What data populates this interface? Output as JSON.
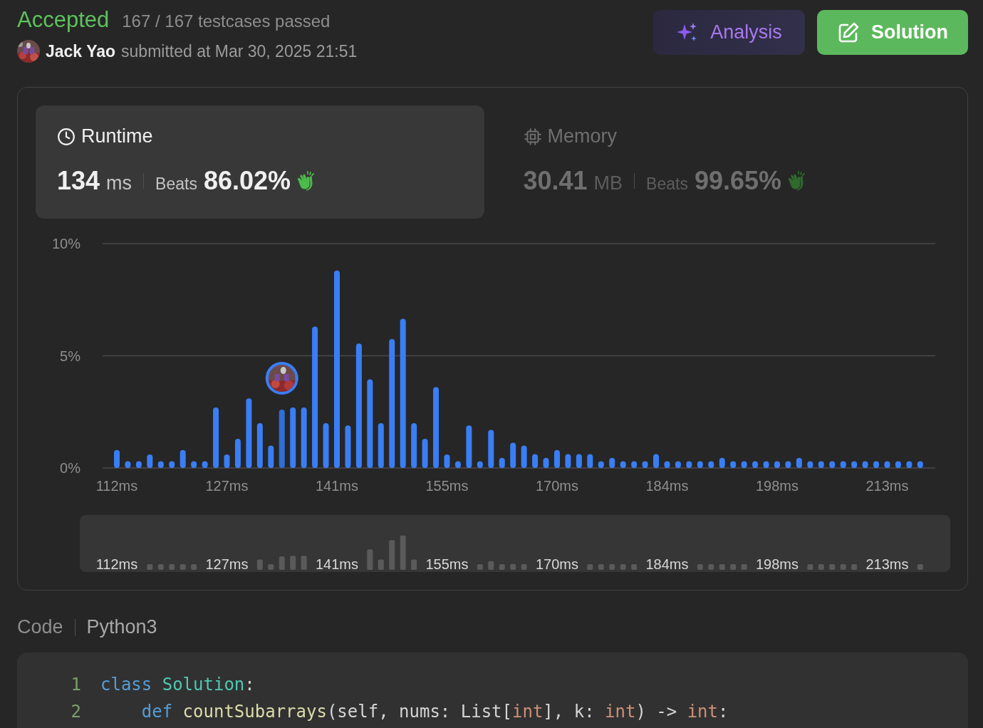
{
  "header": {
    "status": "Accepted",
    "testcases": "167 / 167 testcases passed",
    "author": "Jack Yao",
    "submitted": "submitted at Mar 30, 2025 21:51"
  },
  "buttons": [
    {
      "label": "Analysis",
      "kind": "analysis"
    },
    {
      "label": "Solution",
      "kind": "solution"
    }
  ],
  "metrics": [
    {
      "title": "Runtime",
      "kind": "runtime",
      "selected": true,
      "value": "134",
      "unit": "ms",
      "beats_label": "Beats",
      "beats": "86.02%"
    },
    {
      "title": "Memory",
      "kind": "memory",
      "selected": false,
      "value": "30.41",
      "unit": "MB",
      "beats_label": "Beats",
      "beats": "99.65%"
    }
  ],
  "chart_data": {
    "type": "bar",
    "ylim": [
      0,
      10
    ],
    "yticks": [
      {
        "value": 0,
        "label": "0%"
      },
      {
        "value": 5,
        "label": "5%"
      },
      {
        "value": 10,
        "label": "10%"
      }
    ],
    "categories": [
      "112ms",
      null,
      null,
      null,
      null,
      null,
      null,
      null,
      null,
      null,
      "127ms",
      null,
      null,
      null,
      null,
      null,
      null,
      null,
      null,
      null,
      "141ms",
      null,
      null,
      null,
      null,
      null,
      null,
      null,
      null,
      null,
      "155ms",
      null,
      null,
      null,
      null,
      null,
      null,
      null,
      null,
      null,
      "170ms",
      null,
      null,
      null,
      null,
      null,
      null,
      null,
      null,
      null,
      "184ms",
      null,
      null,
      null,
      null,
      null,
      null,
      null,
      null,
      null,
      "198ms",
      null,
      null,
      null,
      null,
      null,
      null,
      null,
      null,
      null,
      "213ms",
      null,
      null,
      null
    ],
    "values": [
      0.8,
      0.3,
      0.3,
      0.6,
      0.3,
      0.3,
      0.8,
      0.3,
      0.3,
      2.7,
      0.6,
      1.3,
      3.1,
      2.0,
      1.0,
      2.6,
      2.7,
      2.7,
      6.3,
      2.0,
      8.8,
      1.9,
      5.55,
      3.95,
      2.0,
      5.75,
      6.65,
      2.0,
      1.3,
      3.6,
      0.6,
      0.3,
      1.9,
      0.3,
      1.7,
      0.45,
      1.13,
      1.0,
      0.62,
      0.45,
      0.8,
      0.62,
      0.62,
      0.62,
      0.3,
      0.45,
      0.3,
      0.3,
      0.3,
      0.62,
      0.3,
      0.3,
      0.3,
      0.3,
      0.3,
      0.45,
      0.3,
      0.3,
      0.3,
      0.3,
      0.3,
      0.3,
      0.45,
      0.3,
      0.3,
      0.3,
      0.3,
      0.3,
      0.3,
      0.3,
      0.3,
      0.3,
      0.3,
      0.3
    ]
  },
  "bars": [
    {
      "selected": false
    },
    {
      "selected": false
    },
    {
      "selected": false
    },
    {
      "selected": false
    },
    {
      "selected": false
    },
    {
      "selected": false
    },
    {
      "selected": false
    },
    {
      "selected": false
    },
    {
      "selected": false
    },
    {
      "selected": false
    },
    {
      "selected": false
    },
    {
      "selected": false
    },
    {
      "selected": false
    },
    {
      "selected": false
    },
    {
      "selected": false
    },
    {
      "selected": true
    },
    {
      "selected": false
    },
    {
      "selected": false
    },
    {
      "selected": false
    },
    {
      "selected": false
    },
    {
      "selected": false
    },
    {
      "selected": false
    },
    {
      "selected": false
    },
    {
      "selected": false
    },
    {
      "selected": false
    },
    {
      "selected": false
    },
    {
      "selected": false
    },
    {
      "selected": false
    },
    {
      "selected": false
    },
    {
      "selected": false
    },
    {
      "selected": false
    },
    {
      "selected": false
    },
    {
      "selected": false
    },
    {
      "selected": false
    },
    {
      "selected": false
    },
    {
      "selected": false
    },
    {
      "selected": false
    },
    {
      "selected": false
    },
    {
      "selected": false
    },
    {
      "selected": false
    },
    {
      "selected": false
    },
    {
      "selected": false
    },
    {
      "selected": false
    },
    {
      "selected": false
    },
    {
      "selected": false
    },
    {
      "selected": false
    },
    {
      "selected": false
    },
    {
      "selected": false
    },
    {
      "selected": false
    },
    {
      "selected": false
    },
    {
      "selected": false
    },
    {
      "selected": false
    },
    {
      "selected": false
    },
    {
      "selected": false
    },
    {
      "selected": false
    },
    {
      "selected": false
    },
    {
      "selected": false
    },
    {
      "selected": false
    },
    {
      "selected": false
    },
    {
      "selected": false
    },
    {
      "selected": false
    },
    {
      "selected": false
    },
    {
      "selected": false
    },
    {
      "selected": false
    },
    {
      "selected": false
    },
    {
      "selected": false
    },
    {
      "selected": false
    },
    {
      "selected": false
    },
    {
      "selected": false
    },
    {
      "selected": false
    },
    {
      "selected": false
    },
    {
      "selected": false
    },
    {
      "selected": false
    },
    {
      "selected": false
    }
  ],
  "navigator": {
    "labels": [
      "112ms",
      "127ms",
      "141ms",
      "155ms",
      "170ms",
      "184ms",
      "198ms",
      "213ms"
    ]
  },
  "code": {
    "label": "Code",
    "language": "Python3",
    "lines": [
      {
        "number": "1",
        "tokens": [
          {
            "text": "class",
            "kind": "keyword"
          },
          {
            "text": " Solution",
            "kind": "class"
          },
          {
            "text": ":",
            "kind": "plain"
          }
        ]
      },
      {
        "number": "2",
        "tokens": [
          {
            "text": "    def",
            "kind": "keyword"
          },
          {
            "text": " countSubarrays",
            "kind": "func"
          },
          {
            "text": "(self, nums: List[",
            "kind": "plain"
          },
          {
            "text": "int",
            "kind": "type"
          },
          {
            "text": "], k: ",
            "kind": "plain"
          },
          {
            "text": "int",
            "kind": "type"
          },
          {
            "text": ") -> ",
            "kind": "plain"
          },
          {
            "text": "int",
            "kind": "type"
          },
          {
            "text": ":",
            "kind": "plain"
          }
        ]
      }
    ]
  }
}
